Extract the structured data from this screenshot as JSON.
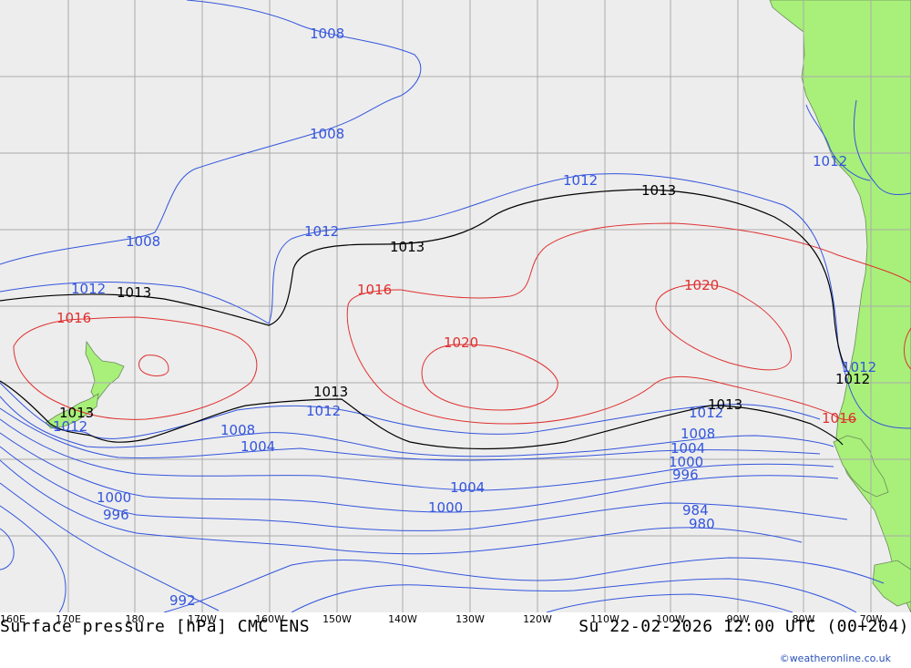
{
  "footer": {
    "left": "Surface pressure [hPa] CMC ENS",
    "right": "Su 22-02-2026 12:00 UTC (00+204)"
  },
  "credit": "©weatheronline.co.uk",
  "longitude_ticks": [
    "160E",
    "170E",
    "180",
    "170W",
    "160W",
    "150W",
    "140W",
    "130W",
    "120W",
    "110W",
    "100W",
    "90W",
    "80W",
    "70W"
  ],
  "isobar_labels": [
    "1008",
    "1008",
    "1008",
    "1012",
    "1012",
    "1013",
    "1013",
    "1013",
    "1013",
    "1013",
    "1016",
    "1016",
    "1016",
    "1020",
    "1020",
    "1012",
    "1012",
    "1012",
    "1012",
    "1012",
    "1012",
    "1008",
    "1004",
    "1000",
    "996",
    "1008",
    "1004",
    "1000",
    "996",
    "1004",
    "1000",
    "984",
    "980",
    "992",
    "1013",
    "1012"
  ],
  "colors": {
    "ocean": "#ededed",
    "land": "#a8f07a",
    "grid": "#aaaaaa",
    "isobar_low": "#3355dd",
    "isobar_high": "#e03030",
    "isobar_ref": "#000000"
  },
  "chart_data": {
    "type": "map",
    "variable": "Surface pressure [hPa]",
    "model": "CMC ENS",
    "valid_time": "Su 22-02-2026 12:00 UTC (00+204)",
    "isobar_values_hpa": [
      980,
      984,
      992,
      996,
      1000,
      1004,
      1008,
      1012,
      1013,
      1016,
      1020
    ],
    "reference_isobar_hpa": 1013
  }
}
